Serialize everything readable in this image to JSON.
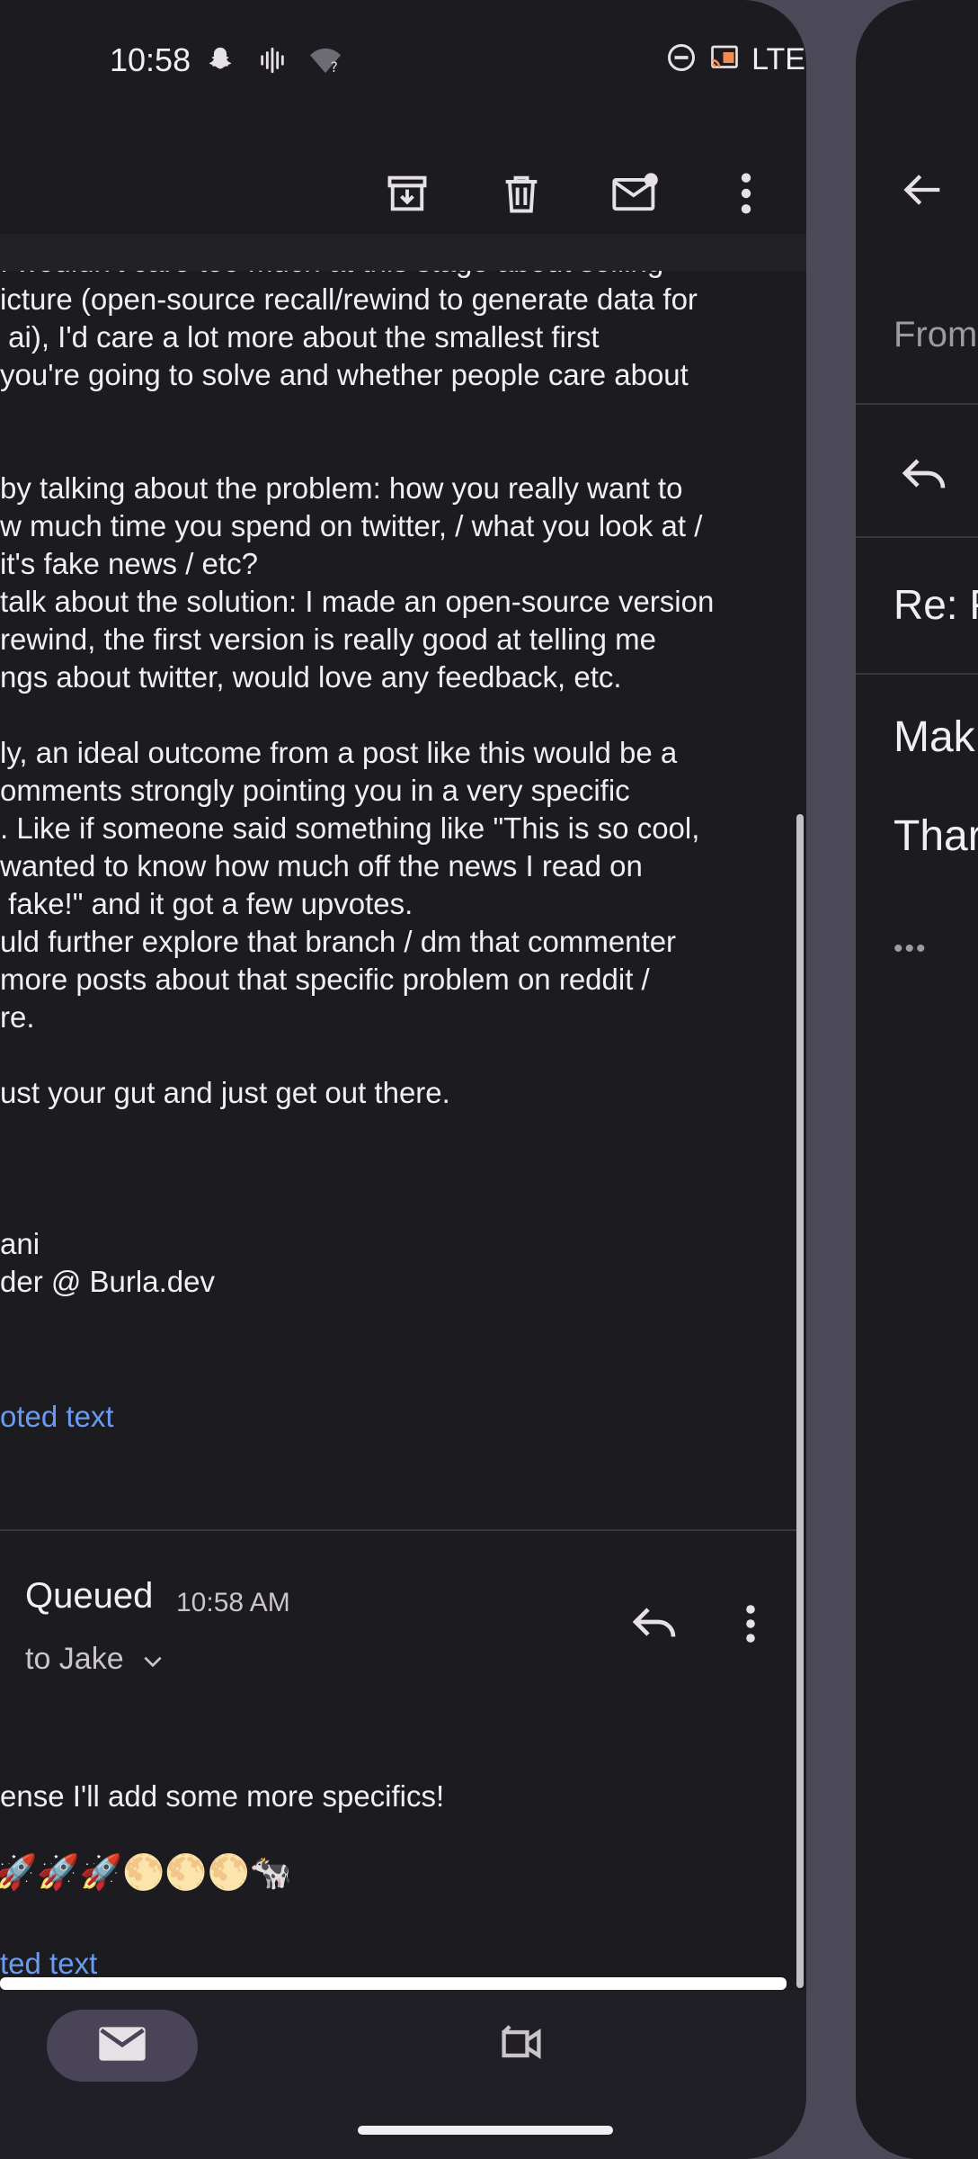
{
  "status_bar": {
    "time": "10:58",
    "network": "LTE",
    "icons": [
      "snapchat-icon",
      "voicemail-icon",
      "wifi-unknown-icon",
      "dnd-icon",
      "cast-icon",
      "signal-icon",
      "battery-icon"
    ]
  },
  "toolbar": {
    "actions": [
      "archive-icon",
      "delete-icon",
      "mark-unread-icon",
      "more-options-icon"
    ]
  },
  "email_body": {
    "lines": [
      "I wouldn't care too much at this stage about selling",
      "icture (open-source recall/rewind to generate data for",
      " ai), I'd care a lot more about the smallest first",
      "you're going to solve and whether people care about",
      "",
      "",
      "by talking about the problem: how you really want to",
      "w much time you spend on twitter, / what you look at /",
      "it's fake news / etc?",
      "talk about the solution: I made an open-source version",
      "rewind, the first version is really good at telling me",
      "ngs about twitter, would love any feedback, etc.",
      "",
      "ly, an ideal outcome from a post like this would be a",
      "omments strongly pointing you in a very specific",
      ". Like if someone said something like \"This is so cool,",
      "wanted to know how much off the news I read on",
      " fake!\" and it got a few upvotes.",
      "uld further explore that branch / dm that commenter",
      "more posts about that specific problem on reddit /",
      "re.",
      "",
      "ust your gut and just get out there.",
      "",
      "",
      "",
      "ani",
      "der @ Burla.dev"
    ],
    "quoted_text_link": "oted text"
  },
  "reply_message": {
    "sender": "Queued",
    "time": "10:58 AM",
    "recipient": "to Jake",
    "body": "ense I'll add some more specifics!",
    "emojis": "🚀🚀🚀🌕🌕🌕🐄",
    "quoted_text_link": "ted text"
  },
  "bottom_nav": {
    "items": [
      "mail-icon",
      "meet-icon"
    ]
  },
  "right_pane": {
    "from_label": "From",
    "subject": "Re: F",
    "line1": "Mak",
    "line2": "Thar",
    "dots": "•••"
  },
  "colors": {
    "background": "#1c1b1f",
    "accent_link": "#6a9bf4",
    "nav_selected": "#4a4458",
    "frame": "#4b4857"
  }
}
